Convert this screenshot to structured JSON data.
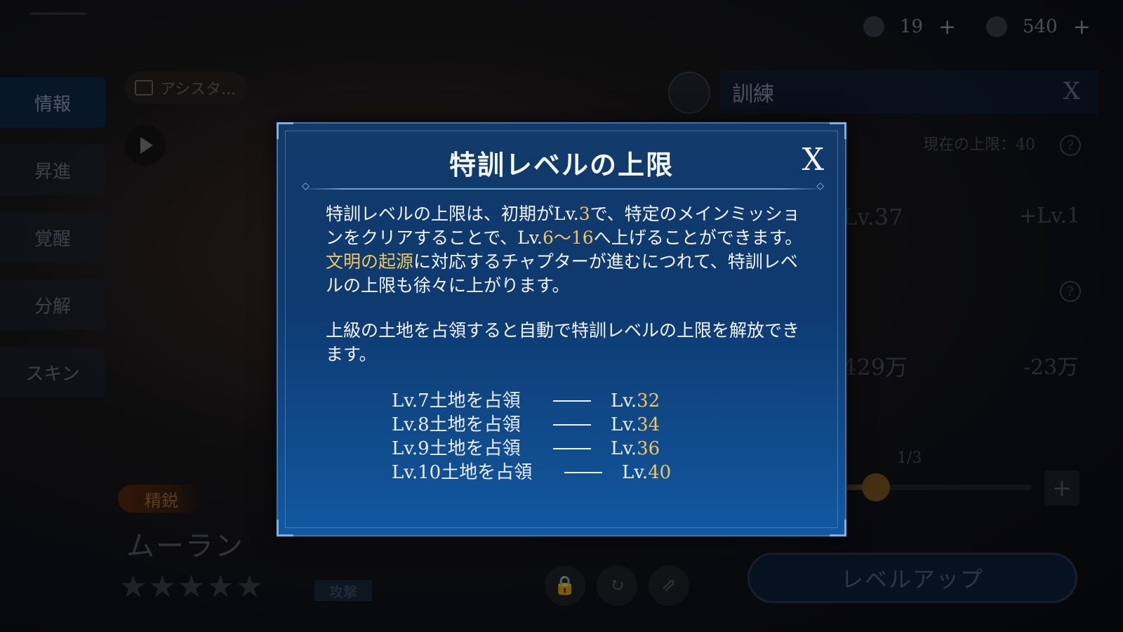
{
  "resources": [
    {
      "icon": "helmet-icon",
      "value": "19"
    },
    {
      "icon": "scroll-icon",
      "value": "540"
    }
  ],
  "side_tabs": [
    "情報",
    "昇進",
    "覚醒",
    "分解",
    "スキン"
  ],
  "assistant_label": "アシスタ...",
  "hero": {
    "grade": "精鋭",
    "name": "ムーラン",
    "stars": "★★★★★",
    "role": "攻撃"
  },
  "training": {
    "title": "訓練",
    "close": "X",
    "current_cap": "現在の上限：40",
    "level_current": "Lv.37",
    "level_gain": "+Lv.1",
    "power_value": "429万",
    "power_delta": "-23万",
    "page": "1/3",
    "slider_fraction": 0.3,
    "levelup_label": "レベルアップ"
  },
  "modal": {
    "title": "特訓レベルの上限",
    "close": "X",
    "para1": {
      "a": "特訓レベルの上限は、初期がLv.",
      "b": "3",
      "c": "で、特定のメインミッションをクリアすることで、Lv.",
      "d": "6～16",
      "e": "へ上げることができます。",
      "f": "文明の起源",
      "g": "に対応するチャプターが進むにつれて、特訓レベルの上限も徐々に上がります。"
    },
    "para2": "上級の土地を占領すると自動で特訓レベルの上限を解放できます。",
    "unlocks": [
      {
        "condition": "Lv.7土地を占領",
        "prefix": "Lv.",
        "level": "32"
      },
      {
        "condition": "Lv.8土地を占領",
        "prefix": "Lv.",
        "level": "34"
      },
      {
        "condition": "Lv.9土地を占領",
        "prefix": "Lv.",
        "level": "36"
      },
      {
        "condition": "Lv.10土地を占領",
        "prefix": "Lv.",
        "level": "40"
      }
    ]
  },
  "colors": {
    "highlight": "#f0c45e",
    "modal_bg": "#0e3a70",
    "modal_border": "#3f74ad"
  }
}
